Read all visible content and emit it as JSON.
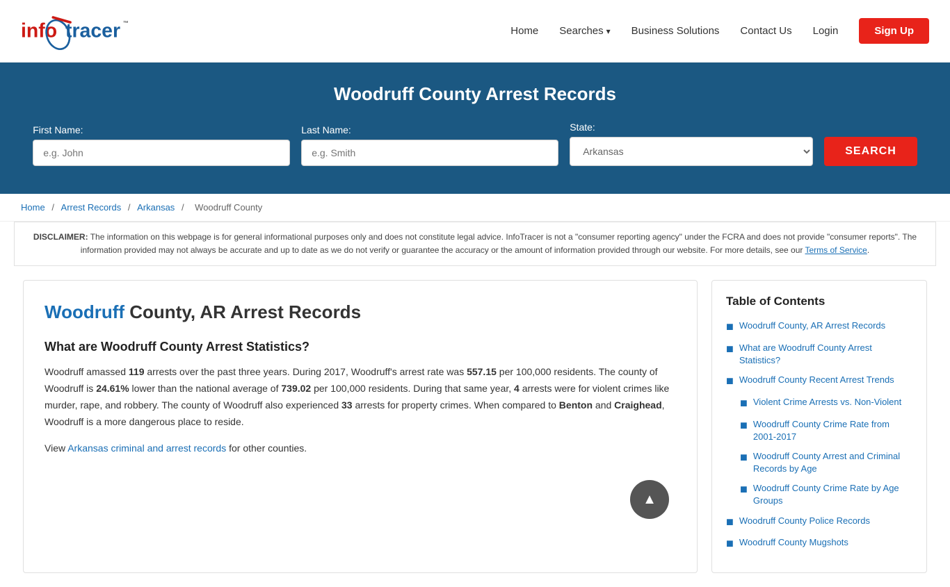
{
  "header": {
    "logo_alt": "InfoTracer",
    "nav": {
      "home": "Home",
      "searches": "Searches",
      "business_solutions": "Business Solutions",
      "contact_us": "Contact Us",
      "login": "Login",
      "signup": "Sign Up"
    }
  },
  "hero": {
    "title": "Woodruff County Arrest Records",
    "form": {
      "first_name_label": "First Name:",
      "first_name_placeholder": "e.g. John",
      "last_name_label": "Last Name:",
      "last_name_placeholder": "e.g. Smith",
      "state_label": "State:",
      "state_value": "Arkansas",
      "search_button": "SEARCH"
    }
  },
  "breadcrumb": {
    "home": "Home",
    "arrest_records": "Arrest Records",
    "arkansas": "Arkansas",
    "woodruff_county": "Woodruff County"
  },
  "disclaimer": {
    "text_bold": "DISCLAIMER:",
    "text": " The information on this webpage is for general informational purposes only and does not constitute legal advice. InfoTracer is not a \"consumer reporting agency\" under the FCRA and does not provide \"consumer reports\". The information provided may not always be accurate and up to date as we do not verify or guarantee the accuracy or the amount of information provided through our website. For more details, see our ",
    "terms_link": "Terms of Service",
    "terms_end": "."
  },
  "article": {
    "title_highlight": "Woodruff",
    "title_rest": " County, AR Arrest Records",
    "section1_title": "What are Woodruff County Arrest Statistics?",
    "paragraph1": "Woodruff amassed ",
    "arrests_count": "119",
    "paragraph1b": " arrests over the past three years. During 2017, Woodruff's arrest rate was ",
    "rate1": "557.15",
    "paragraph1c": " per 100,000 residents. The county of Woodruff is ",
    "pct": "24.61%",
    "paragraph1d": " lower than the national average of ",
    "rate2": "739.02",
    "paragraph1e": " per 100,000 residents. During that same year, ",
    "violent_count": "4",
    "paragraph1f": " arrests were for violent crimes like murder, rape, and robbery. The county of Woodruff also experienced ",
    "property_count": "33",
    "paragraph1g": " arrests for property crimes. When compared to ",
    "city1": "Benton",
    "paragraph1h": " and ",
    "city2": "Craighead",
    "paragraph1i": ", Woodruff is a more dangerous place to reside.",
    "view_text": "View ",
    "view_link_text": "Arkansas criminal and arrest records",
    "view_text2": " for other counties."
  },
  "toc": {
    "title": "Table of Contents",
    "items": [
      {
        "label": "Woodruff County, AR Arrest Records",
        "sub": false
      },
      {
        "label": "What are Woodruff County Arrest Statistics?",
        "sub": false
      },
      {
        "label": "Woodruff County Recent Arrest Trends",
        "sub": false
      },
      {
        "label": "Violent Crime Arrests vs. Non-Violent",
        "sub": true
      },
      {
        "label": "Woodruff County Crime Rate from 2001-2017",
        "sub": true
      },
      {
        "label": "Woodruff County Arrest and Criminal Records by Age",
        "sub": true
      },
      {
        "label": "Woodruff County Crime Rate by Age Groups",
        "sub": true
      },
      {
        "label": "Woodruff County Police Records",
        "sub": false
      },
      {
        "label": "Woodruff County Mugshots",
        "sub": false
      }
    ]
  }
}
